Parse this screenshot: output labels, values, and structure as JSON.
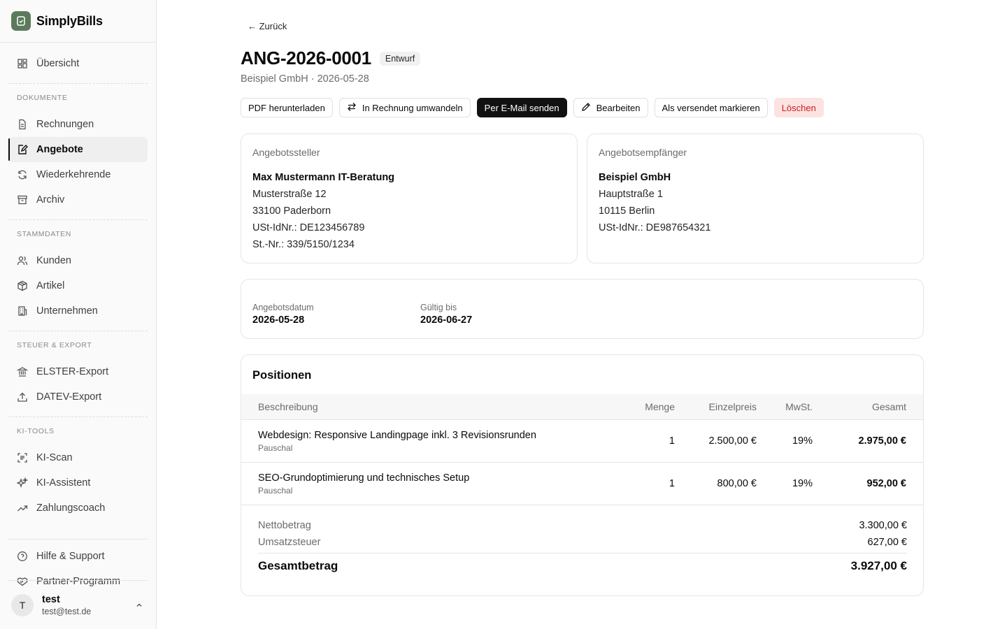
{
  "app": {
    "name": "SimplyBills"
  },
  "sidebar": {
    "overview": "Übersicht",
    "sections": {
      "documents": "DOKUMENTE",
      "master": "STAMMDATEN",
      "tax": "STEUER & EXPORT",
      "ai": "KI-TOOLS"
    },
    "items": {
      "invoices": "Rechnungen",
      "quotes": "Angebote",
      "recurring": "Wiederkehrende",
      "archive": "Archiv",
      "customers": "Kunden",
      "articles": "Artikel",
      "company": "Unternehmen",
      "elster": "ELSTER-Export",
      "datev": "DATEV-Export",
      "kiscan": "KI-Scan",
      "kiassistant": "KI-Assistent",
      "paycoach": "Zahlungscoach",
      "help": "Hilfe & Support",
      "partner": "Partner-Programm"
    },
    "user": {
      "initial": "T",
      "name": "test",
      "email": "test@test.de"
    }
  },
  "header": {
    "back": "← Zurück",
    "title": "ANG-2026-0001",
    "status": "Entwurf",
    "subtitle": "Beispiel GmbH · 2026-05-28"
  },
  "actions": {
    "pdf": "PDF herunterladen",
    "convert": "In Rechnung umwandeln",
    "email": "Per E-Mail senden",
    "edit": "Bearbeiten",
    "mark_sent": "Als versendet markieren",
    "delete": "Löschen"
  },
  "issuer": {
    "label": "Angebotssteller",
    "name": "Max Mustermann IT-Beratung",
    "street": "Musterstraße 12",
    "city": "33100 Paderborn",
    "vat": "USt-IdNr.: DE123456789",
    "tax": "St.-Nr.: 339/5150/1234"
  },
  "recipient": {
    "label": "Angebotsempfänger",
    "name": "Beispiel GmbH",
    "street": "Hauptstraße 1",
    "city": "10115 Berlin",
    "vat": "USt-IdNr.: DE987654321"
  },
  "dates": {
    "quote_label": "Angebotsdatum",
    "quote_value": "2026-05-28",
    "valid_label": "Gültig bis",
    "valid_value": "2026-06-27"
  },
  "positions": {
    "title": "Positionen",
    "columns": {
      "desc": "Beschreibung",
      "qty": "Menge",
      "price": "Einzelpreis",
      "vat": "MwSt.",
      "total": "Gesamt"
    },
    "rows": [
      {
        "desc": "Webdesign: Responsive Landingpage inkl. 3 Revisionsrunden",
        "unit": "Pauschal",
        "qty": "1",
        "price": "2.500,00 €",
        "vat": "19%",
        "total": "2.975,00 €"
      },
      {
        "desc": "SEO-Grundoptimierung und technisches Setup",
        "unit": "Pauschal",
        "qty": "1",
        "price": "800,00 €",
        "vat": "19%",
        "total": "952,00 €"
      }
    ],
    "totals": {
      "net_label": "Nettobetrag",
      "net": "3.300,00 €",
      "tax_label": "Umsatzsteuer",
      "tax": "627,00 €",
      "gross_label": "Gesamtbetrag",
      "gross": "3.927,00 €"
    }
  }
}
